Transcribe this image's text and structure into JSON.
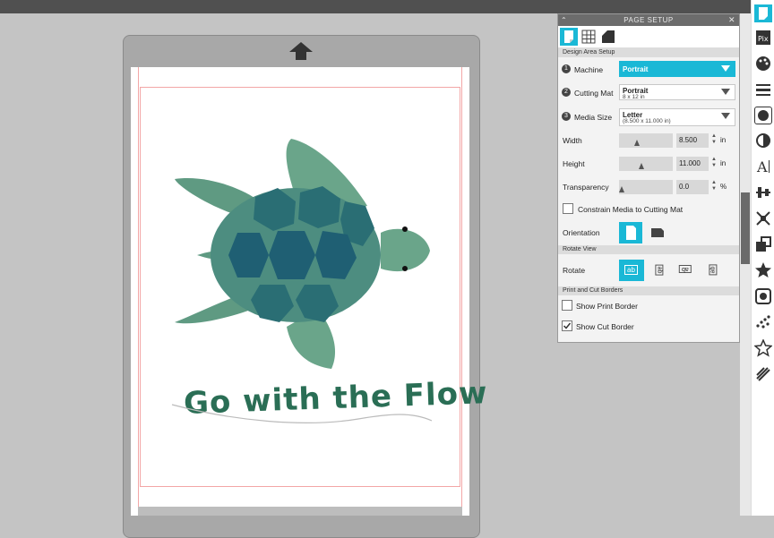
{
  "canvas": {
    "design_text": "Go with the Flow"
  },
  "panel": {
    "title": "PAGE SETUP",
    "section_design_area": "Design Area Setup",
    "machine": {
      "step": "1",
      "label": "Machine",
      "value": "Portrait"
    },
    "cutting_mat": {
      "step": "2",
      "label": "Cutting Mat",
      "value": "Portrait",
      "detail": "8 x 12 in"
    },
    "media_size": {
      "step": "3",
      "label": "Media Size",
      "value": "Letter",
      "detail": "(8.500 x 11.000 in)"
    },
    "width": {
      "label": "Width",
      "value": "8.500",
      "unit": "in"
    },
    "height": {
      "label": "Height",
      "value": "11.000",
      "unit": "in"
    },
    "transparency": {
      "label": "Transparency",
      "value": "0.0",
      "unit": "%"
    },
    "constrain_label": "Constrain Media to Cutting Mat",
    "orientation_label": "Orientation",
    "section_rotate_view": "Rotate View",
    "rotate_label": "Rotate",
    "rotate_options": [
      "ab",
      "ab",
      "ab",
      "ab"
    ],
    "section_borders": "Print and Cut Borders",
    "show_print_border": {
      "label": "Show Print Border",
      "checked": false
    },
    "show_cut_border": {
      "label": "Show Cut Border",
      "checked": true
    }
  },
  "colors": {
    "accent": "#1ab8d6",
    "turtle_dark": "#1f5f73",
    "turtle_light": "#6aa58a",
    "text_green": "#2a6e55"
  }
}
